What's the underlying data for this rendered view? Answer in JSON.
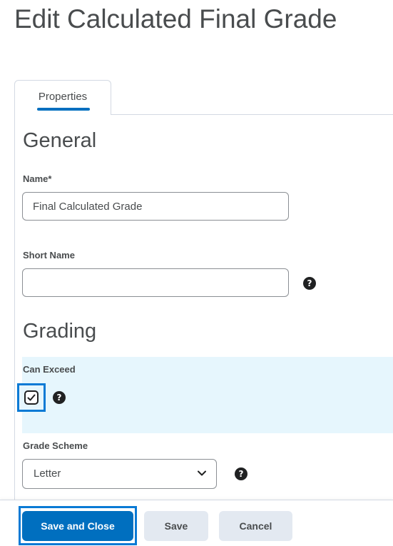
{
  "page": {
    "title": "Edit Calculated Final Grade"
  },
  "tabs": [
    {
      "label": "Properties",
      "active": true
    }
  ],
  "general": {
    "heading": "General",
    "name": {
      "label": "Name",
      "required_marker": "*",
      "value": "Final Calculated Grade"
    },
    "short_name": {
      "label": "Short Name",
      "value": ""
    }
  },
  "grading": {
    "heading": "Grading",
    "can_exceed": {
      "label": "Can Exceed",
      "checked": true
    },
    "grade_scheme": {
      "label": "Grade Scheme",
      "selected": "Letter"
    }
  },
  "footer": {
    "save_and_close": "Save and Close",
    "save": "Save",
    "cancel": "Cancel"
  },
  "icons": {
    "help": "question-circle-icon",
    "check": "checkmark-icon",
    "chevron": "chevron-down-icon"
  },
  "colors": {
    "primary": "#006fbf",
    "focus": "#0a7ad5",
    "highlight": "#e6f6fd",
    "secondary_button": "#e3e9f1"
  }
}
